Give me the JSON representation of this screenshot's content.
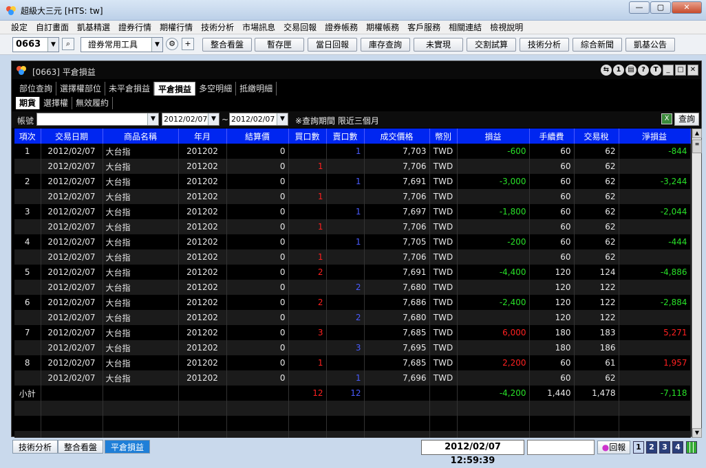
{
  "app": {
    "title": "超級大三元  [HTS: tw]",
    "min": "—",
    "max": "▢",
    "close": "✕"
  },
  "menu": [
    "設定",
    "自訂畫面",
    "凱基精選",
    "證券行情",
    "期權行情",
    "技術分析",
    "市場訊息",
    "交易回報",
    "證券帳務",
    "期權帳務",
    "客戶服務",
    "相關連結",
    "檢視說明"
  ],
  "toolbar": {
    "stock_code": "0663",
    "tool_select": "證券常用工具",
    "buttons": [
      "整合看盤",
      "暫存匣",
      "當日回報",
      "庫存查詢",
      "未實現",
      "交割試算",
      "技術分析",
      "綜合新聞",
      "凱基公告"
    ]
  },
  "panel": {
    "title": "[0663] 平倉損益",
    "tabs": [
      "部位查詢",
      "選擇權部位",
      "未平倉損益",
      "平倉損益",
      "多空明細",
      "抵繳明細"
    ],
    "subtabs": [
      "期貨",
      "選擇權",
      "無效履約"
    ],
    "filter": {
      "account_label": "帳號",
      "account_value": "",
      "date_from": "2012/02/07",
      "tilde": "~",
      "date_to": "2012/02/07",
      "note": "※查詢期間 限近三個月",
      "query_button": "查詢"
    }
  },
  "table": {
    "headers": [
      "項次",
      "交易日期",
      "商品名稱",
      "年月",
      "結算價",
      "買口數",
      "賣口數",
      "成交價格",
      "幣別",
      "損益",
      "手續費",
      "交易稅",
      "淨損益"
    ],
    "rows": [
      [
        "1",
        "2012/02/07",
        "大台指",
        "201202",
        "0",
        "",
        "1",
        "7,703",
        "TWD",
        "-600",
        "60",
        "62",
        "-844"
      ],
      [
        "",
        "2012/02/07",
        "大台指",
        "201202",
        "0",
        "1",
        "",
        "7,706",
        "TWD",
        "",
        "60",
        "62",
        ""
      ],
      [
        "2",
        "2012/02/07",
        "大台指",
        "201202",
        "0",
        "",
        "1",
        "7,691",
        "TWD",
        "-3,000",
        "60",
        "62",
        "-3,244"
      ],
      [
        "",
        "2012/02/07",
        "大台指",
        "201202",
        "0",
        "1",
        "",
        "7,706",
        "TWD",
        "",
        "60",
        "62",
        ""
      ],
      [
        "3",
        "2012/02/07",
        "大台指",
        "201202",
        "0",
        "",
        "1",
        "7,697",
        "TWD",
        "-1,800",
        "60",
        "62",
        "-2,044"
      ],
      [
        "",
        "2012/02/07",
        "大台指",
        "201202",
        "0",
        "1",
        "",
        "7,706",
        "TWD",
        "",
        "60",
        "62",
        ""
      ],
      [
        "4",
        "2012/02/07",
        "大台指",
        "201202",
        "0",
        "",
        "1",
        "7,705",
        "TWD",
        "-200",
        "60",
        "62",
        "-444"
      ],
      [
        "",
        "2012/02/07",
        "大台指",
        "201202",
        "0",
        "1",
        "",
        "7,706",
        "TWD",
        "",
        "60",
        "62",
        ""
      ],
      [
        "5",
        "2012/02/07",
        "大台指",
        "201202",
        "0",
        "2",
        "",
        "7,691",
        "TWD",
        "-4,400",
        "120",
        "124",
        "-4,886"
      ],
      [
        "",
        "2012/02/07",
        "大台指",
        "201202",
        "0",
        "",
        "2",
        "7,680",
        "TWD",
        "",
        "120",
        "122",
        ""
      ],
      [
        "6",
        "2012/02/07",
        "大台指",
        "201202",
        "0",
        "2",
        "",
        "7,686",
        "TWD",
        "-2,400",
        "120",
        "122",
        "-2,884"
      ],
      [
        "",
        "2012/02/07",
        "大台指",
        "201202",
        "0",
        "",
        "2",
        "7,680",
        "TWD",
        "",
        "120",
        "122",
        ""
      ],
      [
        "7",
        "2012/02/07",
        "大台指",
        "201202",
        "0",
        "3",
        "",
        "7,685",
        "TWD",
        "6,000",
        "180",
        "183",
        "5,271"
      ],
      [
        "",
        "2012/02/07",
        "大台指",
        "201202",
        "0",
        "",
        "3",
        "7,695",
        "TWD",
        "",
        "180",
        "186",
        ""
      ],
      [
        "8",
        "2012/02/07",
        "大台指",
        "201202",
        "0",
        "1",
        "",
        "7,685",
        "TWD",
        "2,200",
        "60",
        "61",
        "1,957"
      ],
      [
        "",
        "2012/02/07",
        "大台指",
        "201202",
        "0",
        "",
        "1",
        "7,696",
        "TWD",
        "",
        "60",
        "62",
        ""
      ]
    ],
    "subtotal": [
      "小計",
      "",
      "",
      "",
      "",
      "12",
      "12",
      "",
      "",
      "-4,200",
      "1,440",
      "1,478",
      "-7,118"
    ]
  },
  "bottom": {
    "tabs": [
      "技術分析",
      "整合看盤",
      "平倉損益"
    ],
    "clock": "2012/02/07 12:59:39",
    "report_button": "回報",
    "pages": [
      "1",
      "2",
      "3",
      "4"
    ]
  },
  "colors": {
    "header_blue": "#0026f0",
    "positive": "#ff2020",
    "negative": "#28e028",
    "sell": "#4a5cff"
  }
}
